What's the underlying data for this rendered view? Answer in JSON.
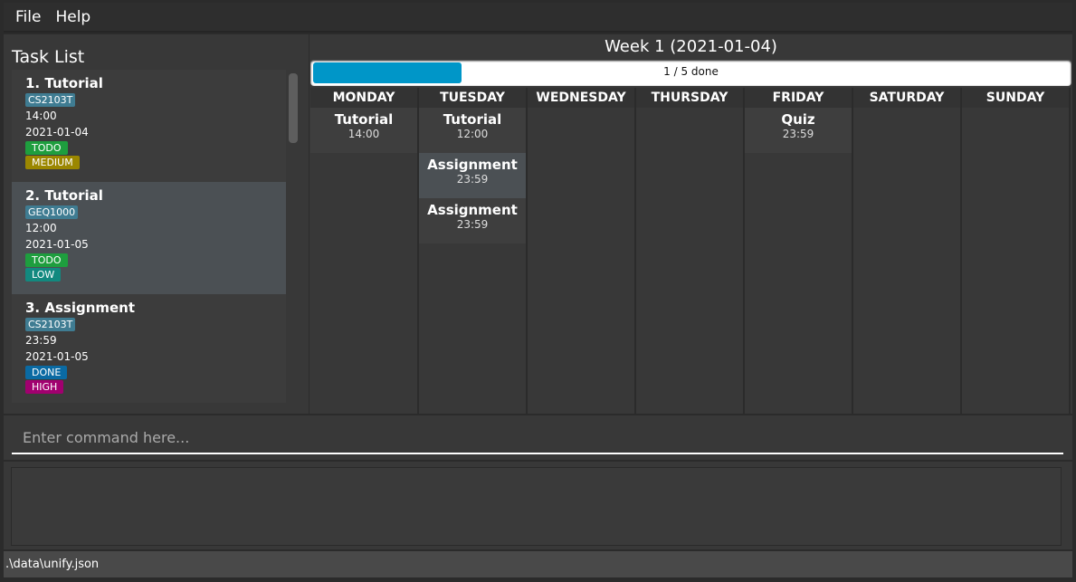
{
  "menu": {
    "file": "File",
    "help": "Help"
  },
  "task_list": {
    "title": "Task List",
    "tasks": [
      {
        "title": "1.  Tutorial",
        "module": "CS2103T",
        "time": "14:00",
        "date": "2021-01-04",
        "status": "TODO",
        "priority": "MEDIUM"
      },
      {
        "title": "2.  Tutorial",
        "module": "GEQ1000",
        "time": "12:00",
        "date": "2021-01-05",
        "status": "TODO",
        "priority": "LOW"
      },
      {
        "title": "3.  Assignment",
        "module": "CS2103T",
        "time": "23:59",
        "date": "2021-01-05",
        "status": "DONE",
        "priority": "HIGH"
      }
    ]
  },
  "colors": {
    "module": "#3f7c92",
    "TODO": "#1e9e3e",
    "DONE": "#0a6aa3",
    "MEDIUM": "#9b8700",
    "LOW": "#12897f",
    "HIGH": "#a1006f",
    "progress": "#0096c8"
  },
  "calendar": {
    "title": "Week 1 (2021-01-04)",
    "progress_text": "1 / 5 done",
    "progress_fraction": 0.2,
    "days": [
      {
        "name": "MONDAY",
        "events": [
          {
            "name": "Tutorial",
            "time": "14:00"
          }
        ]
      },
      {
        "name": "TUESDAY",
        "events": [
          {
            "name": "Tutorial",
            "time": "12:00"
          },
          {
            "name": "Assignment",
            "time": "23:59",
            "selected": true
          },
          {
            "name": "Assignment",
            "time": "23:59"
          }
        ]
      },
      {
        "name": "WEDNESDAY",
        "events": []
      },
      {
        "name": "THURSDAY",
        "events": []
      },
      {
        "name": "FRIDAY",
        "events": [
          {
            "name": "Quiz",
            "time": "23:59"
          }
        ]
      },
      {
        "name": "SATURDAY",
        "events": []
      },
      {
        "name": "SUNDAY",
        "events": []
      }
    ]
  },
  "command": {
    "placeholder": "Enter command here...",
    "value": ""
  },
  "result": {
    "text": ""
  },
  "status": {
    "path": ".\\data\\unify.json"
  }
}
